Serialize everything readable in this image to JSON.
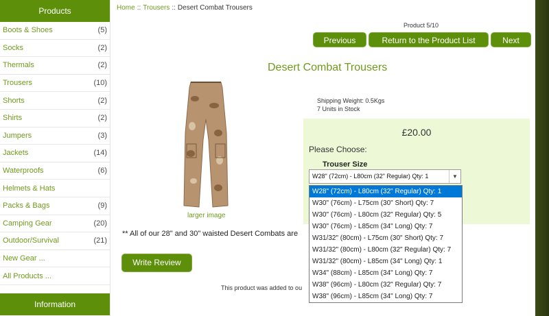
{
  "sidebar": {
    "title": "Products",
    "items": [
      {
        "label": "Boots & Shoes",
        "count": "(5)"
      },
      {
        "label": "Socks",
        "count": "(2)"
      },
      {
        "label": "Thermals",
        "count": "(2)"
      },
      {
        "label": "Trousers",
        "count": "(10)"
      },
      {
        "label": "Shorts",
        "count": "(2)"
      },
      {
        "label": "Shirts",
        "count": "(2)"
      },
      {
        "label": "Jumpers",
        "count": "(3)"
      },
      {
        "label": "Jackets",
        "count": "(14)"
      },
      {
        "label": "Waterproofs",
        "count": "(6)"
      },
      {
        "label": "Helmets & Hats",
        "count": ""
      },
      {
        "label": "Packs & Bags",
        "count": "(9)"
      },
      {
        "label": "Camping Gear",
        "count": "(20)"
      },
      {
        "label": "Outdoor/Survival",
        "count": "(21)"
      },
      {
        "label": "New Gear ...",
        "count": ""
      },
      {
        "label": "All Products ...",
        "count": ""
      }
    ],
    "info_title": "Information"
  },
  "breadcrumb": {
    "home": "Home",
    "category": "Trousers",
    "current": "Desert Combat Trousers",
    "sep": "::"
  },
  "nav": {
    "product_count": "Product 5/10",
    "previous": "Previous",
    "return": "Return to the Product List",
    "next": "Next"
  },
  "product": {
    "title": "Desert Combat Trousers",
    "larger_image": "larger image",
    "shipping_weight": "Shipping Weight: 0.5Kgs",
    "stock": "7 Units in Stock",
    "price": "£20.00",
    "please_choose": "Please Choose:",
    "attribute_label": "Trouser Size",
    "selected_option": "W28\" (72cm) - L80cm (32\" Regular) Qty: 1",
    "note": "** All of our 28\" and 30\" waisted Desert Combats are",
    "write_review": "Write Review",
    "added_text": "This product was added to ou"
  },
  "options": [
    "W28\" (72cm) - L80cm (32\" Regular) Qty: 1",
    "W30\" (76cm) - L75cm (30\" Short) Qty: 7",
    "W30\" (76cm) - L80cm (32\" Regular) Qty: 5",
    "W30\" (76cm) - L85cm (34\" Long) Qty: 7",
    "W31/32\" (80cm) - L75cm (30\" Short) Qty: 7",
    "W31/32\" (80cm) - L80cm (32\" Regular) Qty: 7",
    "W31/32\" (80cm) - L85cm (34\" Long) Qty: 1",
    "W34\" (88cm) - L85cm (34\" Long) Qty: 7",
    "W38\" (96cm) - L80cm (32\" Regular) Qty: 7",
    "W38\" (96cm) - L85cm (34\" Long) Qty: 7"
  ],
  "colors": {
    "brand_green": "#5e8f0b",
    "link_green": "#6f9a1c",
    "price_bg": "#ecf8d6",
    "selected_option": "#0078d7"
  }
}
